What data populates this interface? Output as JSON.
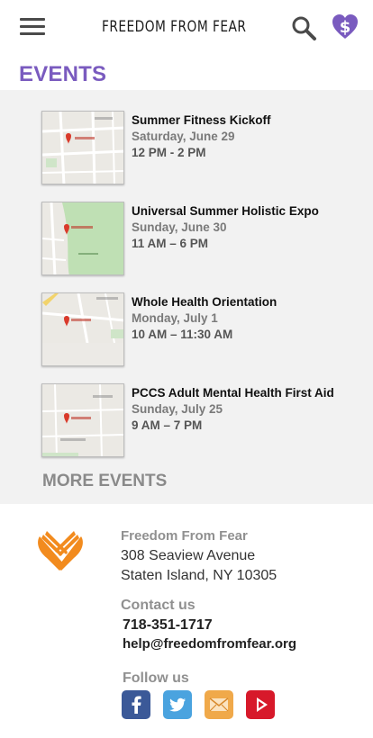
{
  "header": {
    "brand": "FREEDOM FROM FEAR",
    "menu_icon": "hamburger-menu-icon",
    "search_icon": "search-icon",
    "donate_icon": "heart-dollar-icon"
  },
  "page": {
    "heading": "EVENTS",
    "more_events": "MORE EVENTS"
  },
  "events": [
    {
      "title": "Summer Fitness Kickoff",
      "date": "Saturday, June 29",
      "time": "12 PM - 2 PM"
    },
    {
      "title": "Universal Summer Holistic Expo",
      "date": "Sunday, June 30",
      "time": "11 AM – 6 PM"
    },
    {
      "title": "Whole Health Orientation",
      "date": "Monday, July 1",
      "time": "10 AM – 11:30 AM"
    },
    {
      "title": "PCCS Adult Mental Health First Aid",
      "date": "Sunday, July 25",
      "time": "9 AM – 7 PM"
    }
  ],
  "footer": {
    "org_name": "Freedom From Fear",
    "address_line1": "308 Seaview Avenue",
    "address_line2": "Staten Island, NY 10305",
    "contact_heading": "Contact us",
    "phone": "718-351-1717",
    "email": "help@freedomfromfear.org",
    "follow_heading": "Follow us",
    "social": [
      "facebook-icon",
      "twitter-icon",
      "email-icon",
      "youtube-icon"
    ]
  },
  "colors": {
    "accent_purple": "#7a5bbf",
    "logo_orange": "#f28b1e",
    "facebook": "#3b5998",
    "twitter": "#4aa3df",
    "email": "#f0a94a",
    "youtube": "#d7192a"
  }
}
